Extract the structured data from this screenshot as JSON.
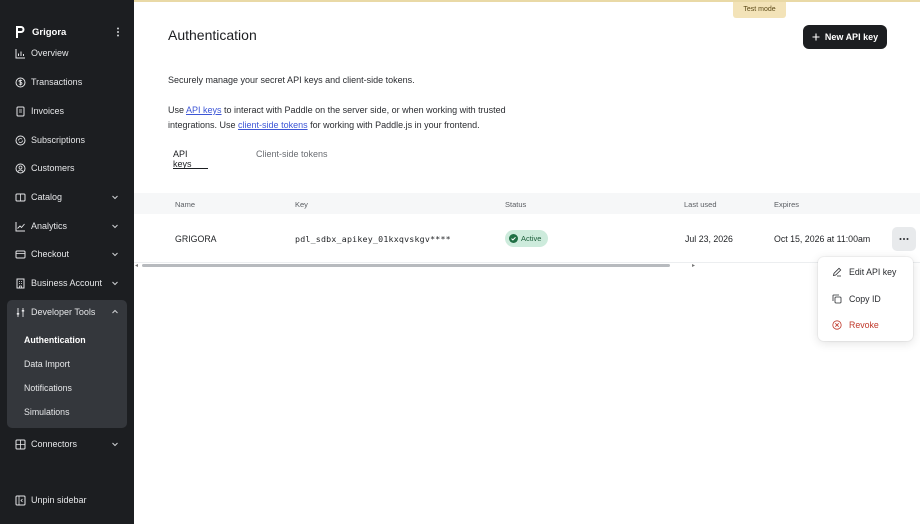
{
  "sidebar": {
    "workspace": "Grigora",
    "items": [
      {
        "label": "Overview",
        "icon": "chart-bar-icon"
      },
      {
        "label": "Transactions",
        "icon": "dollar-circle-icon"
      },
      {
        "label": "Invoices",
        "icon": "invoice-icon"
      },
      {
        "label": "Subscriptions",
        "icon": "subscription-icon"
      },
      {
        "label": "Customers",
        "icon": "user-circle-icon"
      },
      {
        "label": "Catalog",
        "icon": "catalog-icon"
      },
      {
        "label": "Analytics",
        "icon": "analytics-icon"
      },
      {
        "label": "Checkout",
        "icon": "cart-icon"
      },
      {
        "label": "Business Account",
        "icon": "building-icon"
      },
      {
        "label": "Developer Tools",
        "icon": "sliders-icon"
      },
      {
        "label": "Connectors",
        "icon": "grid-plus-icon"
      }
    ],
    "dev_sub": [
      "Authentication",
      "Data Import",
      "Notifications",
      "Simulations"
    ],
    "unpin": "Unpin sidebar"
  },
  "banner": {
    "test_mode": "Test mode"
  },
  "page": {
    "title": "Authentication",
    "new_key": "New API key",
    "desc": "Securely manage your secret API keys and client-side tokens.",
    "desc2_a": "Use ",
    "desc2_link1": "API keys",
    "desc2_b": " to interact with Paddle on the server side, or when working with trusted integrations. Use ",
    "desc2_link2": "client-side tokens",
    "desc2_c": " for working with Paddle.js in your frontend.",
    "tabs": [
      "API keys",
      "Client-side tokens"
    ]
  },
  "table": {
    "headers": [
      "Name",
      "Key",
      "Status",
      "Last used",
      "Expires"
    ],
    "row": {
      "name": "GRIGORA",
      "key": "pdl_sdbx_apikey_01kxqvskgv****",
      "status": "Active",
      "last_used": "Jul 23, 2026",
      "expires": "Oct 15, 2026 at 11:00am"
    }
  },
  "menu": {
    "items": [
      "Edit API key",
      "Copy ID",
      "Revoke"
    ]
  },
  "colors": {
    "sidebar_bg": "#1c1e21",
    "active_badge": "#cdebdc",
    "link": "#3d56d6",
    "danger": "#c0392b"
  }
}
